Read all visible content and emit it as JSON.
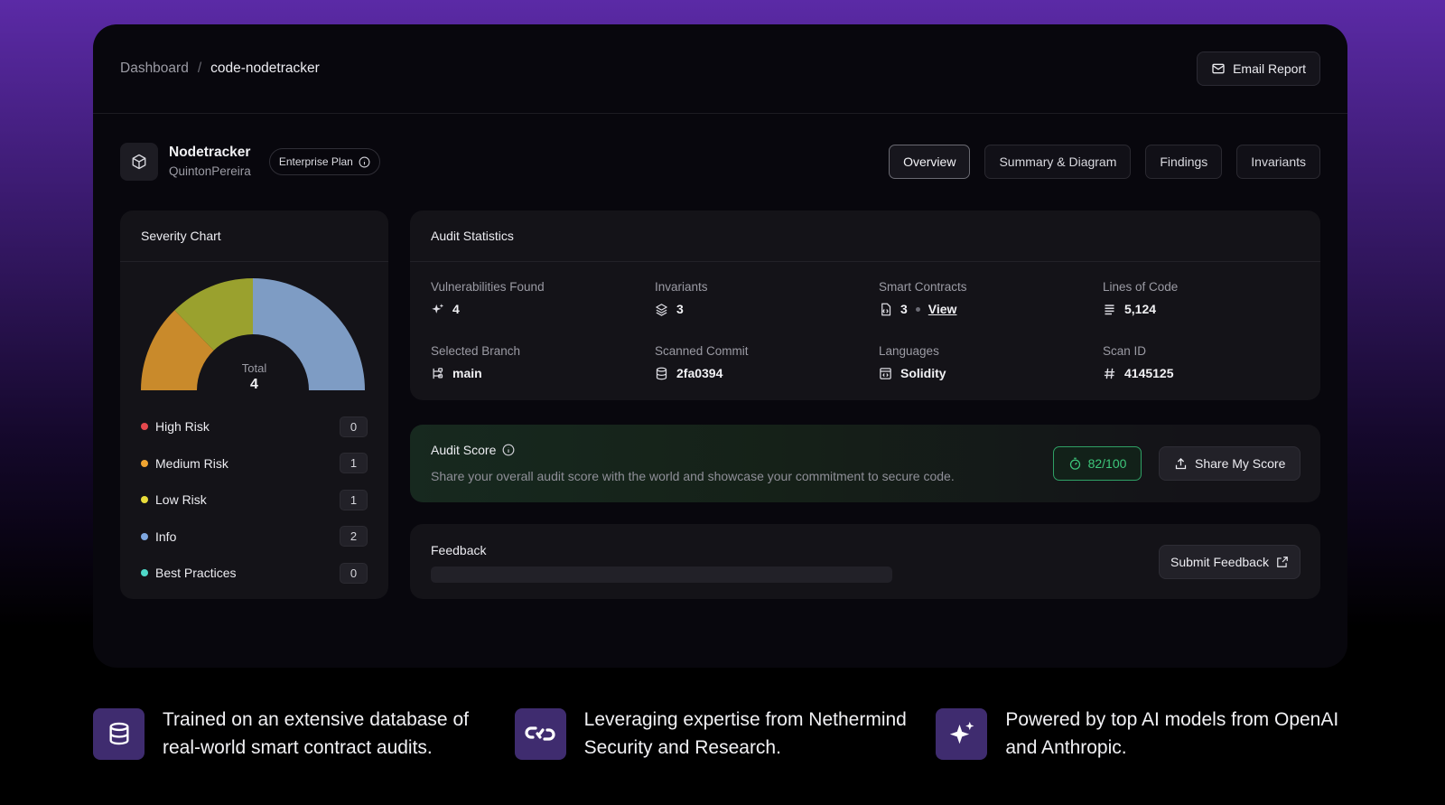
{
  "breadcrumb": {
    "parent": "Dashboard",
    "separator": "/",
    "current": "code-nodetracker"
  },
  "header": {
    "email_report": "Email Report",
    "email_icon": "mail-icon"
  },
  "project": {
    "name": "Nodetracker",
    "owner": "QuintonPereira",
    "plan": "Enterprise Plan",
    "icon": "cube-icon"
  },
  "tabs": [
    {
      "label": "Overview",
      "active": true
    },
    {
      "label": "Summary & Diagram",
      "active": false
    },
    {
      "label": "Findings",
      "active": false
    },
    {
      "label": "Invariants",
      "active": false
    }
  ],
  "severity": {
    "title": "Severity Chart",
    "total_label": "Total",
    "total_value": "4",
    "items": [
      {
        "label": "High Risk",
        "count": "0",
        "color": "#e5484d"
      },
      {
        "label": "Medium Risk",
        "count": "1",
        "color": "#f0a431"
      },
      {
        "label": "Low Risk",
        "count": "1",
        "color": "#e8dc3a"
      },
      {
        "label": "Info",
        "count": "2",
        "color": "#7ea7e0"
      },
      {
        "label": "Best Practices",
        "count": "0",
        "color": "#4fd8c8"
      }
    ],
    "gauge_colors": {
      "medium": "#c98a2b",
      "low": "#9aa12e",
      "info": "#7e9cc4"
    }
  },
  "stats": {
    "title": "Audit Statistics",
    "vulnerabilities": {
      "label": "Vulnerabilities Found",
      "value": "4",
      "icon": "sparkle-icon"
    },
    "invariants": {
      "label": "Invariants",
      "value": "3",
      "icon": "layers-icon"
    },
    "contracts": {
      "label": "Smart Contracts",
      "value": "3",
      "link": "View",
      "icon": "contract-file-icon"
    },
    "loc": {
      "label": "Lines of Code",
      "value": "5,124",
      "icon": "lines-icon"
    },
    "branch": {
      "label": "Selected Branch",
      "value": "main",
      "icon": "branch-icon"
    },
    "commit": {
      "label": "Scanned Commit",
      "value": "2fa0394",
      "icon": "database-icon"
    },
    "languages": {
      "label": "Languages",
      "value": "Solidity",
      "icon": "code-window-icon"
    },
    "scan": {
      "label": "Scan ID",
      "value": "4145125",
      "icon": "hash-icon"
    }
  },
  "score": {
    "title": "Audit Score",
    "description": "Share your overall audit score with the world and showcase your commitment to secure code.",
    "value": "82/100",
    "share": "Share My Score",
    "accent": "#3ec77b"
  },
  "feedback": {
    "title": "Feedback",
    "submit": "Submit Feedback"
  },
  "features": [
    {
      "text": "Trained on an extensive database of real-world smart contract audits.",
      "icon": "database-stack-icon"
    },
    {
      "text": "Leveraging expertise from Nethermind Security and Research.",
      "icon": "nethermind-logo-icon"
    },
    {
      "text": "Powered by top AI models from OpenAI and Anthropic.",
      "icon": "ai-sparkle-icon"
    }
  ]
}
